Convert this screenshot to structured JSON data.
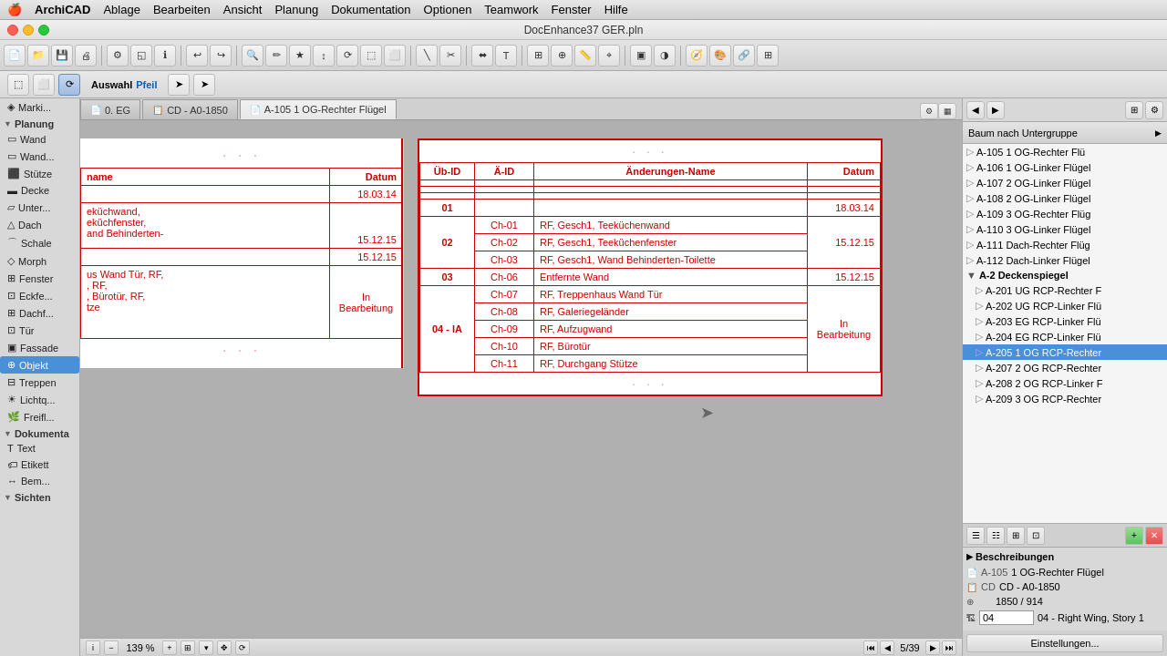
{
  "menubar": {
    "apple": "🍎",
    "items": [
      "ArchiCAD",
      "Ablage",
      "Bearbeiten",
      "Ansicht",
      "Planung",
      "Dokumentation",
      "Optionen",
      "Teamwork",
      "Fenster",
      "Hilfe"
    ]
  },
  "titlebar": {
    "title": "DocEnhance37 GER.pln"
  },
  "sidebar": {
    "selection_label": "Auswahl",
    "arrow_label": "Pfeil",
    "marking_label": "Marki...",
    "sections": [
      {
        "name": "Planung",
        "items": [
          "Wand",
          "Wand...",
          "Stütze",
          "Decke",
          "Unter...",
          "Dach",
          "Schale",
          "Morph",
          "Fenster",
          "Eckfe...",
          "Dachf...",
          "Tür",
          "Fassade",
          "Objekt",
          "Treppen",
          "Lichtq...",
          "Freifl..."
        ]
      },
      {
        "name": "Dokumenta",
        "items": [
          "Text",
          "Etikett",
          "Bem..."
        ]
      },
      {
        "name": "Sichten",
        "items": []
      }
    ]
  },
  "tabs": [
    {
      "label": "0. EG",
      "icon": "📄",
      "active": false
    },
    {
      "label": "CD - A0-1850",
      "icon": "📋",
      "active": false
    },
    {
      "label": "A-105 1 OG-Rechter Flügel",
      "icon": "📄",
      "active": true
    }
  ],
  "table": {
    "headers": [
      "Üb-ID",
      "Ä-ID",
      "Änderungen-Name",
      "Datum"
    ],
    "rows": [
      {
        "ub_id": "01",
        "a_id": "",
        "name": "",
        "datum": "18.03.14"
      },
      {
        "ub_id": "02",
        "a_id": "Ch-01",
        "name": "RF, Gesch1, Teeküchenwand",
        "datum": ""
      },
      {
        "ub_id": "",
        "a_id": "Ch-02",
        "name": "RF, Gesch1, Teeküchenfenster",
        "datum": "15.12.15"
      },
      {
        "ub_id": "",
        "a_id": "Ch-03",
        "name": "RF, Gesch1, Wand Behinderten-Toilette",
        "datum": ""
      },
      {
        "ub_id": "03",
        "a_id": "Ch-06",
        "name": "Entfernte Wand",
        "datum": "15.12.15"
      },
      {
        "ub_id": "",
        "a_id": "Ch-07",
        "name": "RF, Treppenhaus Wand Tür",
        "datum": ""
      },
      {
        "ub_id": "",
        "a_id": "Ch-08",
        "name": "RF, Galeriegeländer",
        "datum": ""
      },
      {
        "ub_id": "04 - IA",
        "a_id": "Ch-09",
        "name": "RF, Aufzugwand",
        "datum": "In Bearbeitung"
      },
      {
        "ub_id": "",
        "a_id": "Ch-10",
        "name": "RF, Bürotür",
        "datum": ""
      },
      {
        "ub_id": "",
        "a_id": "Ch-11",
        "name": "RF, Durchgang Stütze",
        "datum": ""
      }
    ]
  },
  "left_table": {
    "col1": "name",
    "col2": "Datum",
    "rows": [
      {
        "name": "",
        "datum": "18.03.14"
      },
      {
        "name": "eküchwand,\neküchfenster,\nand Behinderten-",
        "datum": "15.12.15"
      },
      {
        "name": "",
        "datum": "15.12.15"
      },
      {
        "name": "us Wand Tür, RF,\n, RF,\n, Bürotür, RF,\ntze",
        "datum": "In Bearbeitung"
      }
    ]
  },
  "right_panel": {
    "tree_header": "Baum nach Untergruppe",
    "tree_items": [
      {
        "id": "A-105 1 OG-Rechter Flü",
        "selected": false
      },
      {
        "id": "A-106 1 OG-Linker Flügel",
        "selected": false
      },
      {
        "id": "A-107 2 OG-Linker Flügel",
        "selected": false
      },
      {
        "id": "A-108 2 OG-Linker Flügel",
        "selected": false
      },
      {
        "id": "A-109 3 OG-Rechter Flüg",
        "selected": false
      },
      {
        "id": "A-110 3 OG-Linker Flügel",
        "selected": false
      },
      {
        "id": "A-111 Dach-Rechter Flüg",
        "selected": false
      },
      {
        "id": "A-112 Dach-Linker Flügel",
        "selected": false
      },
      {
        "id": "A-2 Deckenspiegel",
        "selected": false,
        "section": true
      },
      {
        "id": "A-201 UG RCP-Rechter F",
        "selected": false
      },
      {
        "id": "A-202 UG RCP-Linker Flü",
        "selected": false
      },
      {
        "id": "A-203 EG RCP-Linker Flü",
        "selected": false
      },
      {
        "id": "A-204 EG RCP-Linker Flü",
        "selected": false
      },
      {
        "id": "A-205 1 OG RCP-Rechter",
        "selected": true
      },
      {
        "id": "A-207 2 OG RCP-Rechter",
        "selected": false
      },
      {
        "id": "A-208 2 OG RCP-Linker F",
        "selected": false
      },
      {
        "id": "A-209 3 OG RCP-Rechter",
        "selected": false
      }
    ]
  },
  "beschreibungen": {
    "label": "Beschreibungen",
    "field1_label": "A-105",
    "field1_value": "1 OG-Rechter Flügel",
    "field2_label": "CD",
    "field2_value": "CD - A0-1850",
    "field3_label": "",
    "field3_value": "1850 / 914",
    "field4_label": "04",
    "field4_value": "04 - Right Wing, Story 1"
  },
  "einstellungen": "Einstellungen...",
  "statusbar": {
    "zoom": "139 %",
    "page": "5/39"
  }
}
